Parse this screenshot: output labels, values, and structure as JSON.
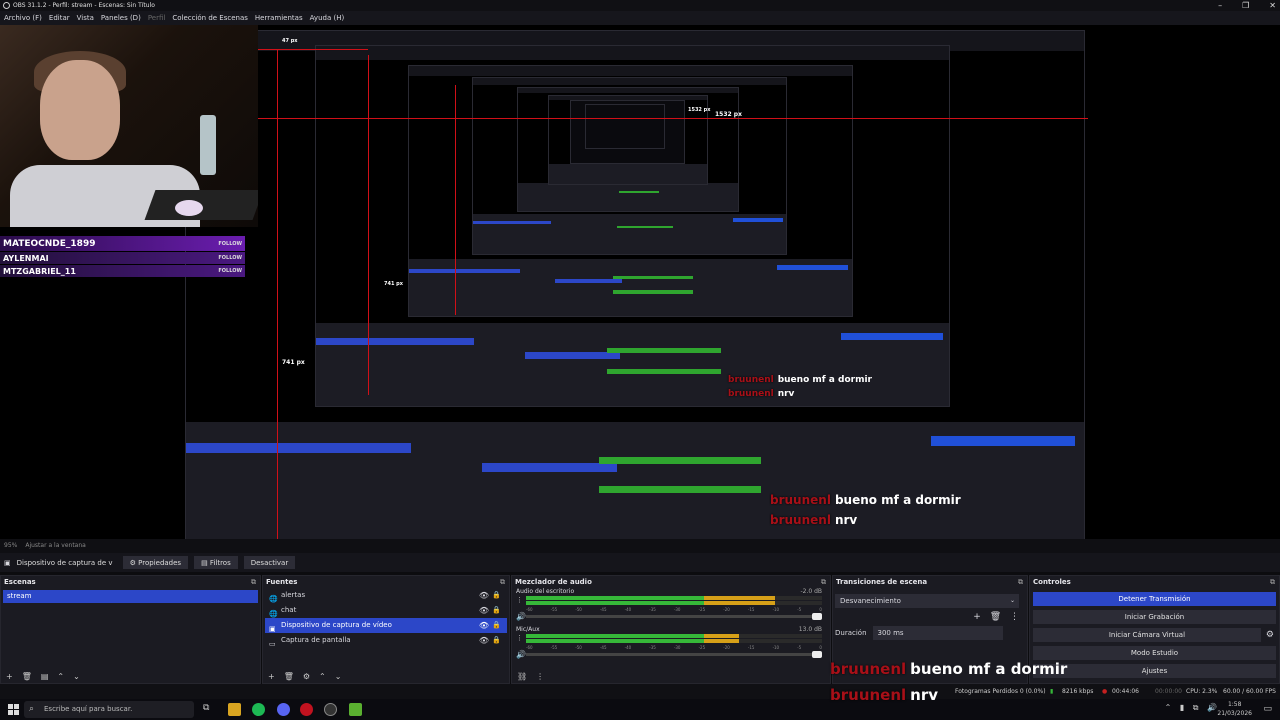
{
  "window": {
    "title": "OBS 31.1.2 - Perfil: stream - Escenas: Sin Título",
    "min": "–",
    "max": "❐",
    "close": "✕"
  },
  "menu": [
    "Archivo (F)",
    "Editar",
    "Vista",
    "Paneles (D)",
    "Perfil",
    "Colección de Escenas",
    "Herramientas",
    "Ayuda (H)"
  ],
  "preview": {
    "px_top": "1532 px",
    "px_left": "741 px",
    "px_top_inner": "47 px",
    "px_top2": "1532 px",
    "px_left2": "741 px"
  },
  "alerts": [
    {
      "name": "MATEOCNDE_1899",
      "follow": "FOLLOW"
    },
    {
      "name": "AYLENMAI",
      "follow": "FOLLOW"
    },
    {
      "name": "MTZGABRIEL_11",
      "follow": "FOLLOW"
    }
  ],
  "context": {
    "zoom": "95%",
    "fit": "Ajustar a la ventana"
  },
  "sourcebar": {
    "source": "Dispositivo de captura de v",
    "props": "Propiedades",
    "filters": "Filtros",
    "deactivate": "Desactivar"
  },
  "scenes": {
    "title": "Escenas",
    "items": [
      "stream"
    ]
  },
  "sources": {
    "title": "Fuentes",
    "items": [
      "alertas",
      "chat",
      "Dispositivo de captura de vídeo",
      "Captura de pantalla"
    ]
  },
  "mixer": {
    "title": "Mezclador de audio",
    "channels": [
      {
        "name": "Audio del escritorio",
        "db": "-2.0 dB",
        "level": 0.84
      },
      {
        "name": "Mic/Aux",
        "db": "13.0 dB",
        "level": 0.72
      }
    ],
    "ticks": [
      "-60",
      "-55",
      "-50",
      "-45",
      "-40",
      "-35",
      "-30",
      "-25",
      "-20",
      "-15",
      "-10",
      "-5",
      "0"
    ]
  },
  "transitions": {
    "title": "Transiciones de escena",
    "selected": "Desvanecimiento",
    "duration_label": "Duración",
    "duration": "300 ms"
  },
  "controls": {
    "title": "Controles",
    "buttons": [
      "Detener Transmisión",
      "Iniciar Grabación",
      "Iniciar Cámara Virtual",
      "Modo Estudio",
      "Ajustes"
    ]
  },
  "chat": [
    {
      "user": "bruunenl",
      "msg": "bueno mf a dormir"
    },
    {
      "user": "bruunenl",
      "msg": "nrv"
    }
  ],
  "status": {
    "dropped": "Fotogramas Perdidos 0 (0.0%)",
    "kbps": "8216 kbps",
    "live": "00:44:06",
    "rec": "00:00:00",
    "cpu": "CPU: 2.3%",
    "fps": "60.00 / 60.00 FPS"
  },
  "taskbar": {
    "search": "Escribe aquí para buscar.",
    "time": "1:58",
    "date": "21/03/2026"
  },
  "colors": {
    "accent": "#2c47c8",
    "meter_green": "#36b839",
    "meter_yellow": "#d6a018",
    "meter_red": "#c42020",
    "chat_user": "#a81018",
    "alert_purple": "#5a1a9a"
  }
}
